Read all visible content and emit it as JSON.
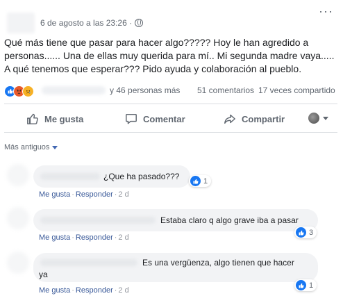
{
  "post": {
    "timestamp": "6 de agosto a las 23:26 ·",
    "more_icon": "···",
    "text_lines": [
      "Qué más tiene que pasar para hacer algo????? Hoy le han agredido a",
      "personas...... Una de ellas muy querida para mí.. Mi segunda madre vaya.....",
      "A qué tenemos que esperar??? Pido ayuda y colaboración al pueblo."
    ]
  },
  "stats": {
    "reaction_icons": [
      "like-icon",
      "angry-icon",
      "sad-icon"
    ],
    "others": "y 46 personas más",
    "comments": "51 comentarios",
    "shares": "17 veces compartido"
  },
  "actions": {
    "like": "Me gusta",
    "comment": "Comentar",
    "share": "Compartir"
  },
  "comments_sort": "Más antiguos",
  "comments": [
    {
      "text": "¿Que ha pasado???",
      "reactions": "1",
      "like": "Me gusta",
      "reply": "Responder",
      "time": "2 d"
    },
    {
      "text": "Estaba claro q algo grave iba a pasar",
      "reactions": "3",
      "like": "Me gusta",
      "reply": "Responder",
      "time": "2 d"
    },
    {
      "text_line1": "Es una vergüenza, algo tienen que hacer",
      "text_line2": "ya",
      "reactions": "1",
      "like": "Me gusta",
      "reply": "Responder",
      "time": "2 d"
    }
  ],
  "colors": {
    "accent": "#1877f2",
    "link": "#385898",
    "muted": "#606770",
    "bubble": "#f2f3f5"
  }
}
